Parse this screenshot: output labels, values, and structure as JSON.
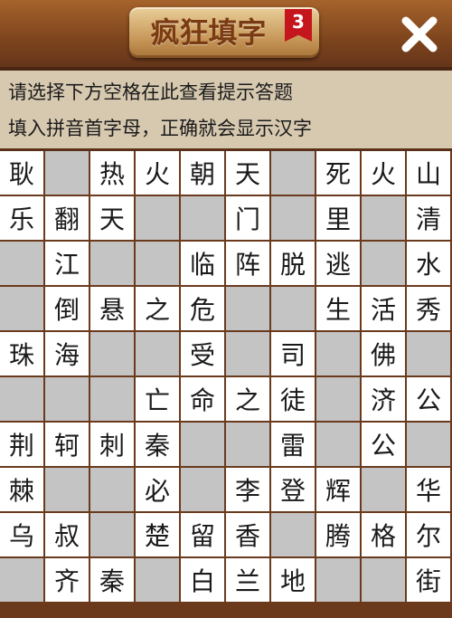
{
  "header": {
    "title": "疯狂填字",
    "level": "3",
    "close_icon": "close-icon"
  },
  "hints": {
    "line1": "请选择下方空格在此查看提示答题",
    "line2": "填入拼音首字母，正确就会显示汉字"
  },
  "grid": {
    "rows": [
      [
        "耿",
        "",
        "热",
        "火",
        "朝",
        "天",
        "",
        "死",
        "火",
        "山"
      ],
      [
        "乐",
        "翻",
        "天",
        "",
        "",
        "门",
        "",
        "里",
        "",
        "清"
      ],
      [
        "",
        "江",
        "",
        "",
        "临",
        "阵",
        "脱",
        "逃",
        "",
        "水"
      ],
      [
        "",
        "倒",
        "悬",
        "之",
        "危",
        "",
        "",
        "生",
        "活",
        "秀"
      ],
      [
        "珠",
        "海",
        "",
        "",
        "受",
        "",
        "司",
        "",
        "佛",
        ""
      ],
      [
        "",
        "",
        "",
        "亡",
        "命",
        "之",
        "徒",
        "",
        "济",
        "公"
      ],
      [
        "荆",
        "轲",
        "刺",
        "秦",
        "",
        "",
        "雷",
        "",
        "公",
        ""
      ],
      [
        "棘",
        "",
        "",
        "必",
        "",
        "李",
        "登",
        "辉",
        "",
        "华"
      ],
      [
        "乌",
        "叔",
        "",
        "楚",
        "留",
        "香",
        "",
        "腾",
        "格",
        "尔"
      ],
      [
        "",
        "齐",
        "秦",
        "",
        "白",
        "兰",
        "地",
        "",
        "",
        "街"
      ]
    ]
  },
  "colors": {
    "cell_filled": "#ffffff",
    "cell_empty": "#c4c4c4",
    "frame": "#6b3a1c",
    "badge": "#c4161c"
  }
}
